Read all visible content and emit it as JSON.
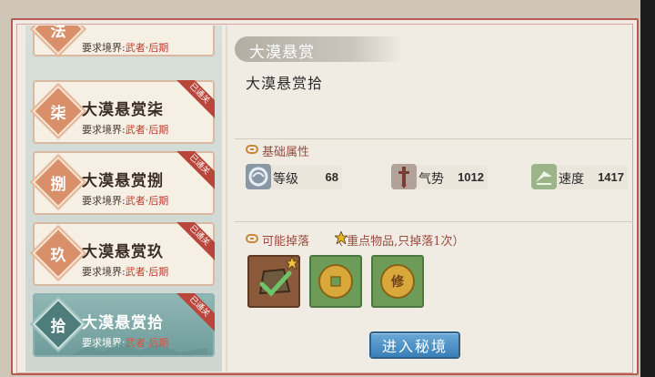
{
  "list": {
    "items": [
      {
        "seal": "法",
        "title": "",
        "req_prefix": "要求境界:",
        "realm": "武者·后期",
        "badge": "",
        "selected": false
      },
      {
        "seal": "柒",
        "title": "大漠悬赏柒",
        "req_prefix": "要求境界:",
        "realm": "武者·后期",
        "badge": "已通关",
        "selected": false
      },
      {
        "seal": "捌",
        "title": "大漠悬赏捌",
        "req_prefix": "要求境界:",
        "realm": "武者·后期",
        "badge": "已通关",
        "selected": false
      },
      {
        "seal": "玖",
        "title": "大漠悬赏玖",
        "req_prefix": "要求境界:",
        "realm": "武者·后期",
        "badge": "已通关",
        "selected": false
      },
      {
        "seal": "拾",
        "title": "大漠悬赏拾",
        "req_prefix": "要求境界:",
        "realm": "武者·后期",
        "badge": "已通关",
        "selected": true
      }
    ]
  },
  "detail": {
    "header": "大漠悬赏",
    "name": "大漠悬赏拾",
    "attrs_label": "基础属性",
    "stats": [
      {
        "label": "等级",
        "value": "68",
        "icon": "level-icon"
      },
      {
        "label": "气势",
        "value": "1012",
        "icon": "momentum-icon"
      },
      {
        "label": "速度",
        "value": "1417",
        "icon": "speed-icon"
      }
    ],
    "drops_label": "可能掉落",
    "drops_note": "（ 重点物品,只掉落1次）",
    "drops": [
      {
        "name": "treasure-pouch-icon",
        "starred": true
      },
      {
        "name": "copper-coin-icon",
        "starred": false
      },
      {
        "name": "cultivation-coin-icon",
        "starred": false,
        "glyph": "修"
      }
    ],
    "enter_button": "进入秘境"
  },
  "colors": {
    "frame": "#b65a52",
    "realm": "#c0392b",
    "selected_bg": "#7aa8a6",
    "button": "#3a7fb8"
  }
}
